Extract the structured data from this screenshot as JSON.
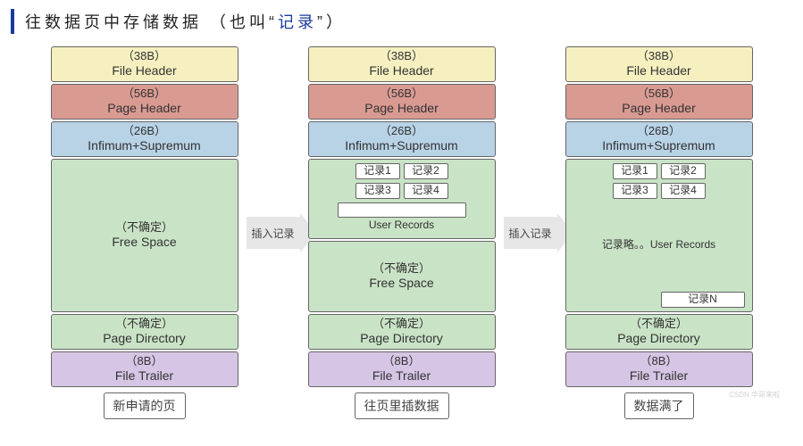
{
  "title": {
    "pre": "往数据页中存储数据  （也叫“",
    "hl": "记录",
    "post": "”）"
  },
  "labels": {
    "fileHeaderSize": "（38B）",
    "fileHeader": "File Header",
    "pageHeaderSize": "（56B）",
    "pageHeader": "Page Header",
    "infimumSize": "（26B）",
    "infimum": "Infimum+Supremum",
    "freeSpaceSize": "（不确定）",
    "freeSpace": "Free Space",
    "userRecords": "User Records",
    "pageDirSize": "（不确定）",
    "pageDir": "Page Directory",
    "fileTrailerSize": "（8B）",
    "fileTrailer": "File Trailer"
  },
  "records": {
    "r1": "记录1",
    "r2": "记录2",
    "r3": "记录3",
    "r4": "记录4",
    "rn": "记录N",
    "omit": "记录略。。User Records"
  },
  "arrows": {
    "insert": "插入记录"
  },
  "captions": {
    "c1": "新申请的页",
    "c2": "往页里插数据",
    "c3": "数据满了"
  },
  "watermark": "CSDN 华哥来啦"
}
